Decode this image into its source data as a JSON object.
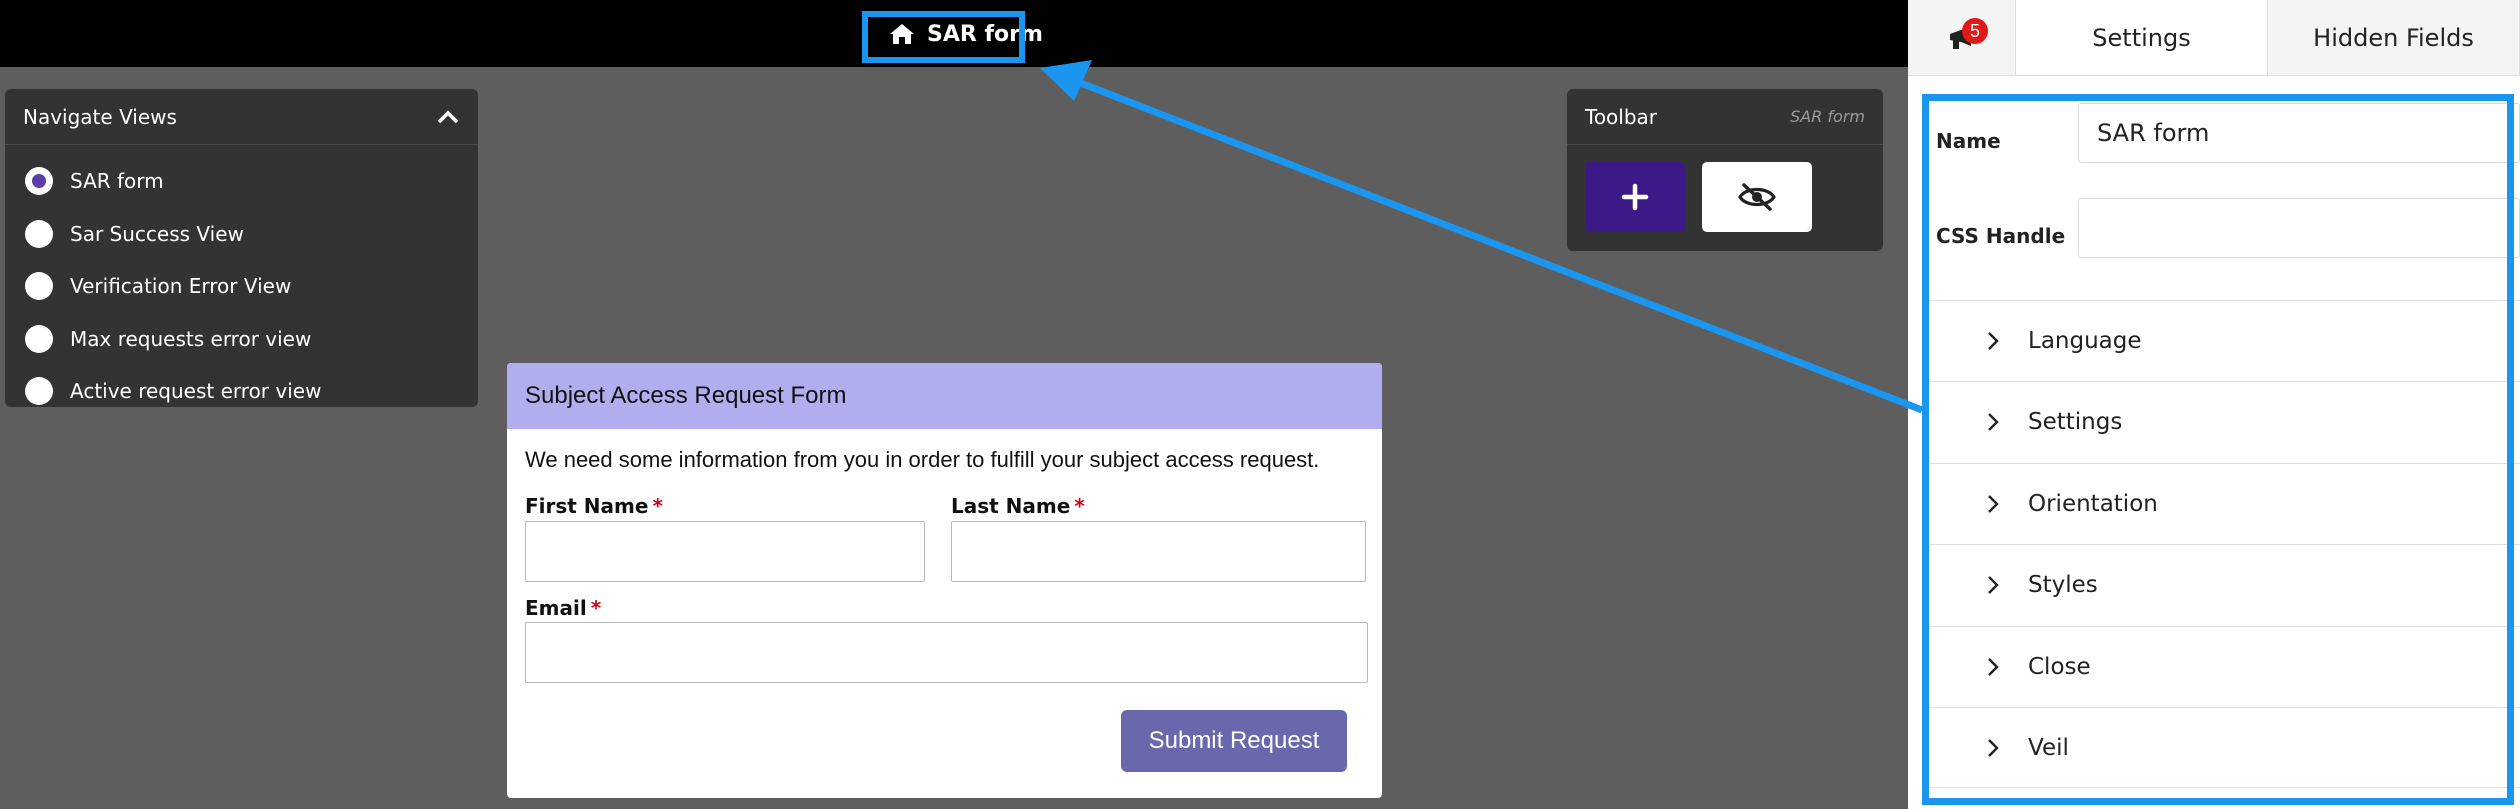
{
  "header": {
    "view_title": "SAR form"
  },
  "navigate_views": {
    "title": "Navigate Views",
    "items": [
      {
        "label": "SAR form",
        "selected": true
      },
      {
        "label": "Sar Success View",
        "selected": false
      },
      {
        "label": "Verification Error View",
        "selected": false
      },
      {
        "label": "Max requests error view",
        "selected": false
      },
      {
        "label": "Active request error view",
        "selected": false
      }
    ]
  },
  "toolbar": {
    "title": "Toolbar",
    "subtitle": "SAR form",
    "add_icon": "plus-icon",
    "hide_icon": "eye-off-icon"
  },
  "form": {
    "heading": "Subject Access Request Form",
    "intro": "We need some information from you in order to fulfill your subject access request.",
    "first_name_label": "First Name",
    "last_name_label": "Last Name",
    "email_label": "Email",
    "required_mark": "*",
    "submit_label": "Submit Request"
  },
  "settings_panel": {
    "badge_count": "5",
    "tabs": [
      "Settings",
      "Hidden Fields"
    ],
    "active_tab": "Settings",
    "name_label": "Name",
    "name_value": "SAR form",
    "css_label": "CSS Handle",
    "css_value": "",
    "sections": [
      "Language",
      "Settings",
      "Orientation",
      "Styles",
      "Close",
      "Veil"
    ]
  },
  "colors": {
    "highlight": "#1a96f0",
    "form_header": "#b1aeef",
    "submit_button": "#6a68ad",
    "add_button": "#3b1a87",
    "badge": "#e01818"
  }
}
